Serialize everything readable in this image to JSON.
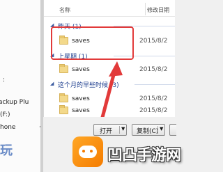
{
  "nav": {
    "colon_fragment": ":",
    "backup_fragment": "ackup Plu",
    "drive_fragment": "(F:)",
    "phone_fragment": "hone",
    "dot_fragment": "·",
    "wan_fragment": "玩"
  },
  "file_list": {
    "col_name": "名称",
    "col_date": "修改日期",
    "groups": [
      {
        "label": "昨天 (1)",
        "chevron": "◢"
      },
      {
        "label": "上星期 (1)",
        "chevron": "◢"
      },
      {
        "label": "这个月的早些时候 (3)",
        "chevron": "◢"
      }
    ],
    "rows": [
      {
        "name": "saves",
        "date": "2015/8/2"
      },
      {
        "name": "saves",
        "date": "2015/8/2"
      },
      {
        "name": "saves",
        "date": "2015/8/2"
      },
      {
        "name": "saves",
        "date": "2015/8/2"
      }
    ]
  },
  "dialog": {
    "open_label": "打开",
    "copy_label": "复制(C)",
    "caret": "▼"
  },
  "watermark": {
    "text": "凹凸手游网"
  },
  "colors": {
    "highlight": "#e23a3a",
    "group_header": "#1f3f8f",
    "watermark_orange": "#f57c00"
  }
}
